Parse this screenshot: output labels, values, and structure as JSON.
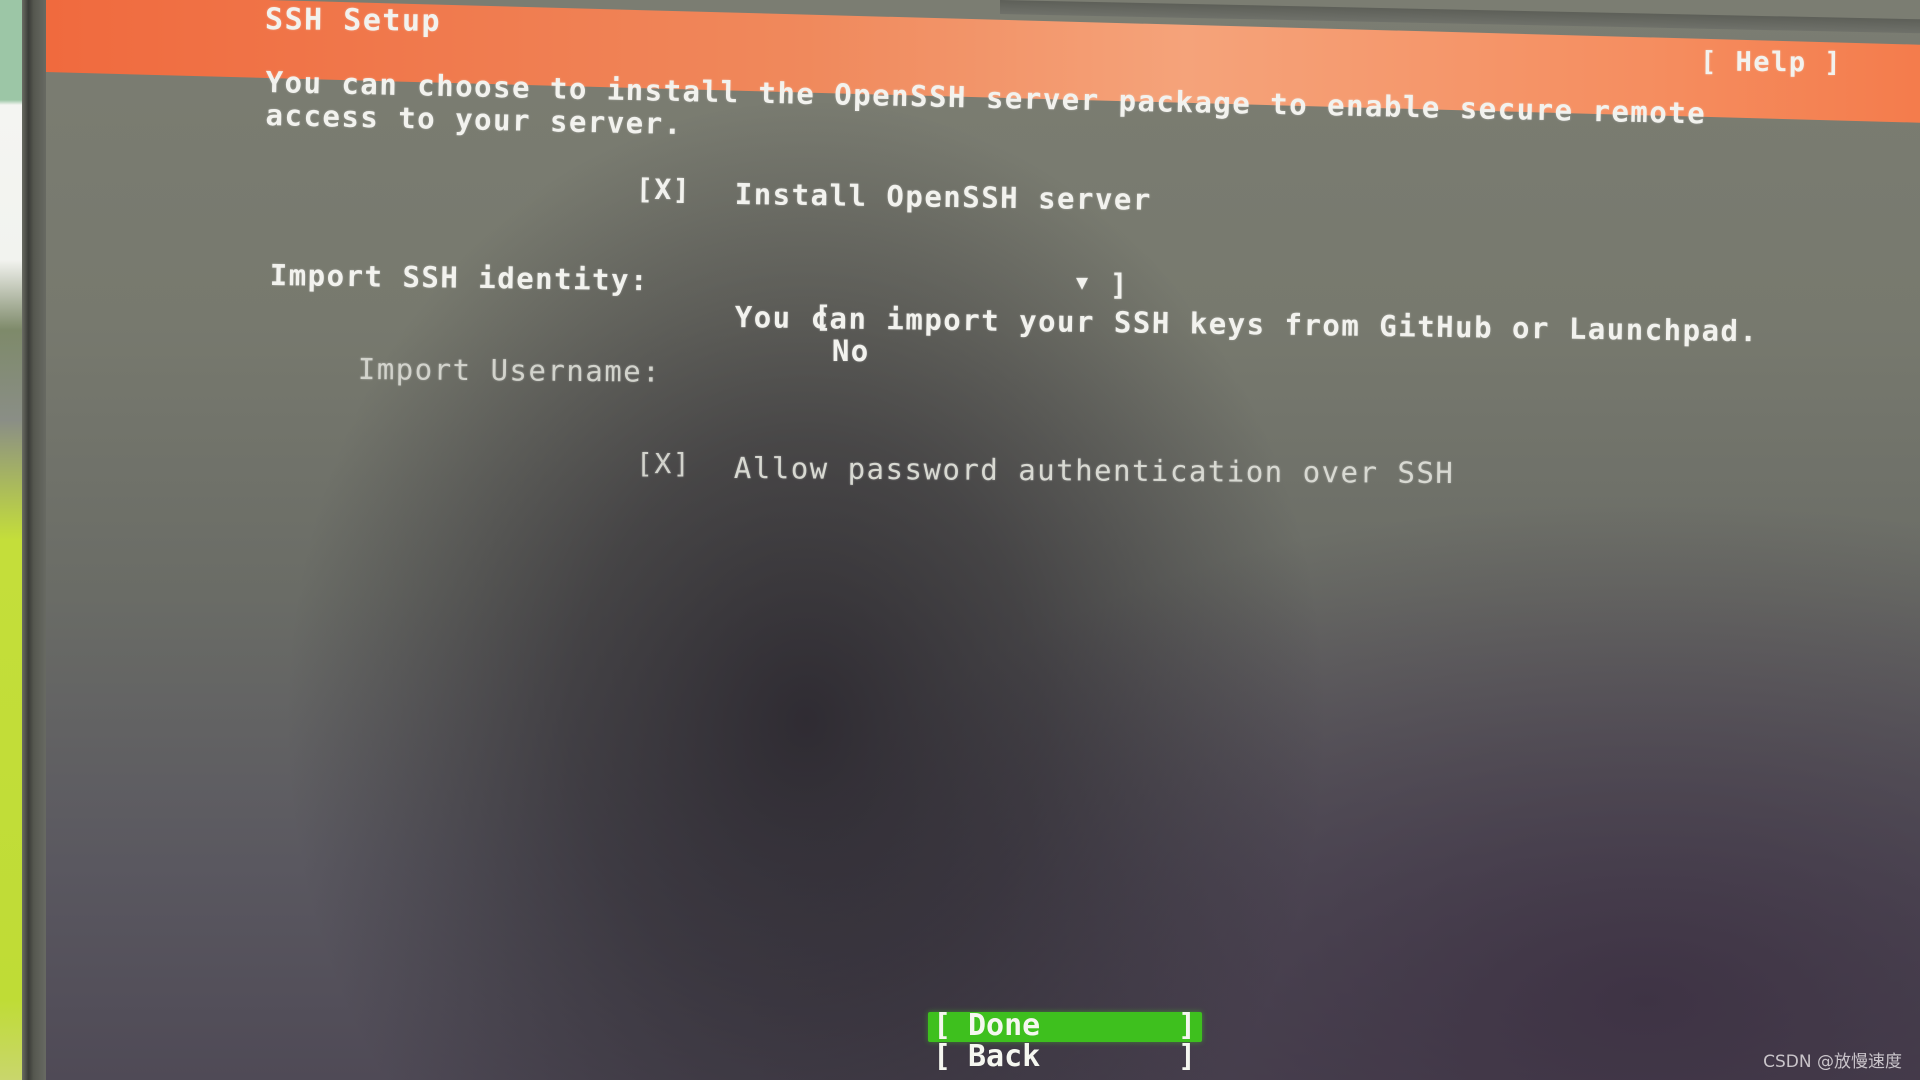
{
  "header": {
    "title": "SSH Setup",
    "help_label": "[ Help ]",
    "accent_color": "#f0895c"
  },
  "description": {
    "line1": "You can choose to install the OpenSSH server package to enable secure remote",
    "line2": "access to your server."
  },
  "form": {
    "install_openssh": {
      "checkbox": "[X]",
      "checked": true,
      "label": "Install OpenSSH server"
    },
    "import_identity": {
      "label": "Import SSH identity:",
      "open_bracket": "[",
      "value": "No",
      "arrow": "▼",
      "close_bracket": "]",
      "helper": "You can import your SSH keys from GitHub or Launchpad."
    },
    "import_username": {
      "label": "Import Username:",
      "value": ""
    },
    "allow_password": {
      "checkbox": "[X]",
      "checked": true,
      "label": "Allow password authentication over SSH"
    }
  },
  "buttons": {
    "done": {
      "open": "[",
      "label": "Done",
      "close": "]",
      "color": "#3ec01e"
    },
    "back": {
      "open": "[",
      "label": "Back",
      "close": "]"
    }
  },
  "watermark": "CSDN @放慢速度"
}
